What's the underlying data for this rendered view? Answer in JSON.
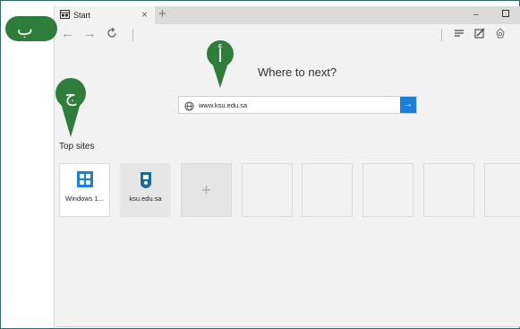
{
  "tab": {
    "title": "Start"
  },
  "page": {
    "heading": "Where to next?",
    "address_value": "www.ksu.edu.sa",
    "top_sites_label": "Top sites"
  },
  "tiles": [
    {
      "label": "Windows 1...",
      "icon": "windows-store-icon"
    },
    {
      "label": "ksu.edu.sa",
      "icon": "ksu-logo-icon"
    }
  ],
  "annotations": {
    "a": "أ",
    "b": "ب",
    "c": "ج"
  },
  "colors": {
    "accent": "#1a7fd8",
    "marker": "#2f7d3a",
    "frame": "#2e6b6b"
  }
}
